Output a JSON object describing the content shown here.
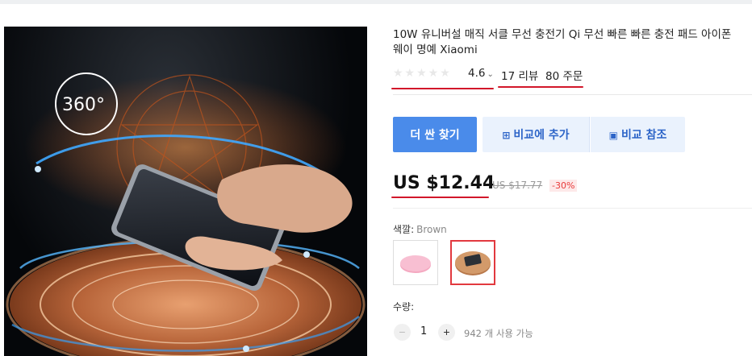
{
  "product": {
    "title_line1": "10W 유니버설 매직 서클 무선 충전기 Qi 무선 빠른 빠른 충전 패드 아이폰",
    "title_line2": "웨이 명예 Xiaomi",
    "stars": "★★★★★",
    "rating": "4.6",
    "rating_chevron": "⌄",
    "reviews": "17 리뷰",
    "orders": "80 주문",
    "image_overlay_text": "360°"
  },
  "actions": {
    "find_cheaper": "더 싼 찾기",
    "add_compare": "비교에 추가",
    "view_compare": "비교 참조",
    "add_compare_icon": "add-to-compare-icon",
    "view_compare_icon": "compare-list-icon"
  },
  "price": {
    "current": "US $12.44",
    "original": "US $17.77",
    "discount": "-30%"
  },
  "color": {
    "label": "색깔:",
    "value": "Brown",
    "options": [
      "pink",
      "brown"
    ],
    "selected": 1
  },
  "quantity": {
    "label": "수량:",
    "value": "1",
    "minus": "−",
    "plus": "+",
    "available": "942 개 사용 가능"
  },
  "colors": {
    "primary_button": "#4a8bea",
    "secondary_button": "#eaf2fd",
    "underline_annotation": "#d2172a",
    "selected_swatch_border": "#e2393f"
  }
}
